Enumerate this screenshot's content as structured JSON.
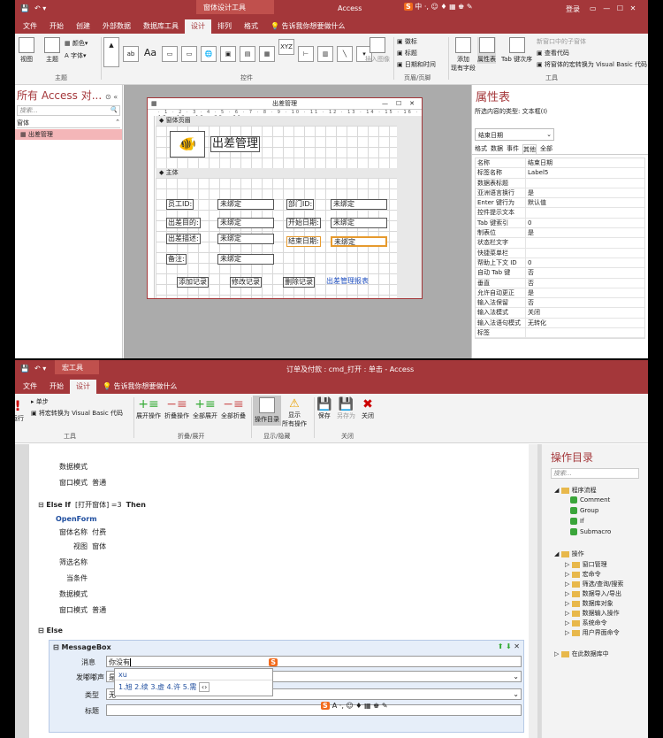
{
  "top": {
    "title_ctx": "窗体设计工具",
    "title_app": "Access",
    "login": "登录",
    "tabs": [
      "文件",
      "开始",
      "创建",
      "外部数据",
      "数据库工具",
      "设计",
      "排列",
      "格式"
    ],
    "active_tab": "设计",
    "tell": "告诉我你想要做什么",
    "ribbon": {
      "view": "视图",
      "theme": "主题",
      "colors": "颜色",
      "fonts": "字体",
      "themes_group": "主题",
      "controls_group": "控件",
      "insert_image": "插入图像",
      "logo": "徽标",
      "title": "标题",
      "datetime": "日期和时间",
      "header_group": "页眉/页脚",
      "add_fields": "添加\n现有字段",
      "property_sheet": "属性表",
      "tab_order": "Tab 键次序",
      "new_window": "新窗口中的子窗体",
      "view_code": "查看代码",
      "convert": "将窗体的宏转换为 Visual Basic 代码",
      "tools_group": "工具"
    },
    "nav": {
      "title": "所有 Access 对...",
      "search": "搜索...",
      "section": "窗体",
      "item": "出差管理"
    },
    "form": {
      "title": "出差管理",
      "header_band": "窗体页眉",
      "detail_band": "主体",
      "heading": "出差管理",
      "labels": [
        "员工ID:",
        "出差目的:",
        "出差描述:",
        "备注:",
        "部门ID:",
        "开始日期:",
        "结束日期:"
      ],
      "unbound": "未绑定",
      "buttons": [
        "添加记录",
        "修改记录",
        "删除记录",
        "出差管理报表"
      ]
    },
    "props": {
      "title": "属性表",
      "sel_type": "所选内容的类型: 文本框(I)",
      "selected": "结束日期",
      "tabs": [
        "格式",
        "数据",
        "事件",
        "其他",
        "全部"
      ],
      "active_tab": "其他",
      "rows": [
        [
          "名称",
          "结束日期"
        ],
        [
          "标签名称",
          "Label5"
        ],
        [
          "数据表标题",
          ""
        ],
        [
          "亚洲语言换行",
          "是"
        ],
        [
          "Enter 键行为",
          "默认值"
        ],
        [
          "控件提示文本",
          ""
        ],
        [
          "Tab 键索引",
          "0"
        ],
        [
          "制表位",
          "是"
        ],
        [
          "状态栏文字",
          ""
        ],
        [
          "快捷菜单栏",
          ""
        ],
        [
          "帮助上下文 ID",
          "0"
        ],
        [
          "自动 Tab 键",
          "否"
        ],
        [
          "垂直",
          "否"
        ],
        [
          "允许自动更正",
          "是"
        ],
        [
          "输入法保留",
          "否"
        ],
        [
          "输入法模式",
          "关闭"
        ],
        [
          "输入法语句模式",
          "无转化"
        ],
        [
          "标签",
          ""
        ]
      ]
    }
  },
  "bottom": {
    "title_ctx": "宏工具",
    "title_main": "订单及付款 : cmd_打开 : 单击  -  Access",
    "tabs": [
      "文件",
      "开始",
      "设计"
    ],
    "active_tab": "设计",
    "tell": "告诉我你想要做什么",
    "ribbon": {
      "run": "运行",
      "single_step": "单步",
      "convert": "将宏转换为 Visual Basic 代码",
      "tools_group": "工具",
      "expand": "展开操作",
      "collapse": "折叠操作",
      "expand_all": "全部展开",
      "collapse_all": "全部折叠",
      "fold_group": "折叠/展开",
      "catalog": "操作目录",
      "show_all": "显示\n所有操作",
      "show_group": "显示/隐藏",
      "save": "保存",
      "save_as": "另存为",
      "close": "关闭",
      "close_group": "关闭"
    },
    "macro": {
      "l1": "数据模式",
      "l2": "窗口模式",
      "l2v": "普通",
      "elseif": "Else If",
      "cond": "[打开窗体] =3",
      "then": "Then",
      "openform": "OpenForm",
      "fname_k": "窗体名称",
      "fname_v": "付费",
      "view_k": "视图",
      "view_v": "窗体",
      "filter": "筛选名称",
      "where": "当条件",
      "datamode": "数据模式",
      "winmode": "窗口模式",
      "winmode_v": "普通",
      "else": "Else",
      "msgbox": "MessageBox",
      "msg_k": "消息",
      "msg_v": "你没有",
      "beep_k": "发嘟嘟声",
      "beep_v": "是",
      "type_k": "类型",
      "type_v": "无",
      "title_k": "标题"
    },
    "ime": {
      "input": "xu",
      "cands": "1.旭  2.续  3.虚  4.许  5.需"
    },
    "catalog": {
      "title": "操作目录",
      "search": "搜索...",
      "flow": "程序流程",
      "flow_items": [
        "Comment",
        "Group",
        "If",
        "Submacro"
      ],
      "ops": "操作",
      "op_items": [
        "窗口管理",
        "宏命令",
        "筛选/查询/搜索",
        "数据导入/导出",
        "数据库对象",
        "数据输入操作",
        "系统命令",
        "用户界面命令"
      ],
      "indb": "在此数据库中"
    }
  },
  "colors": {
    "accent": "#a4373a",
    "ribbon_bg": "#f3f3f3"
  }
}
